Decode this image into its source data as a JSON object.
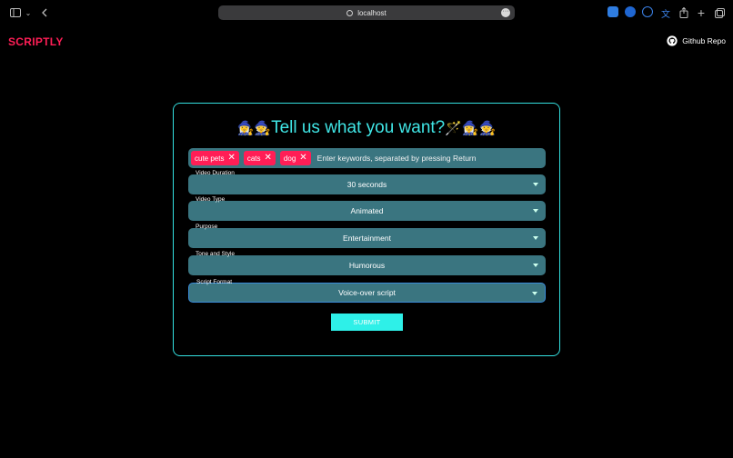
{
  "browser": {
    "url": "localhost"
  },
  "app": {
    "brand": "SCRIPTLY",
    "repo_label": "Github Repo",
    "accent": "#ff1e56",
    "cyan": "#34e0e0"
  },
  "form": {
    "heading": "Tell us what you want?",
    "heading_emoji_left": "🧙‍♀️🧙",
    "heading_emoji_right": "🪄🧙‍♀️🧙",
    "keywords": {
      "tags": [
        "cute pets",
        "cats",
        "dog"
      ],
      "placeholder": "Enter keywords, separated by pressing Return"
    },
    "fields": [
      {
        "label": "Video Duration",
        "value": "30 seconds"
      },
      {
        "label": "Video Type",
        "value": "Animated"
      },
      {
        "label": "Purpose",
        "value": "Entertainment"
      },
      {
        "label": "Tone and Style",
        "value": "Humorous"
      },
      {
        "label": "Script Format",
        "value": "Voice-over script"
      }
    ],
    "submit_label": "SUBMIT"
  }
}
